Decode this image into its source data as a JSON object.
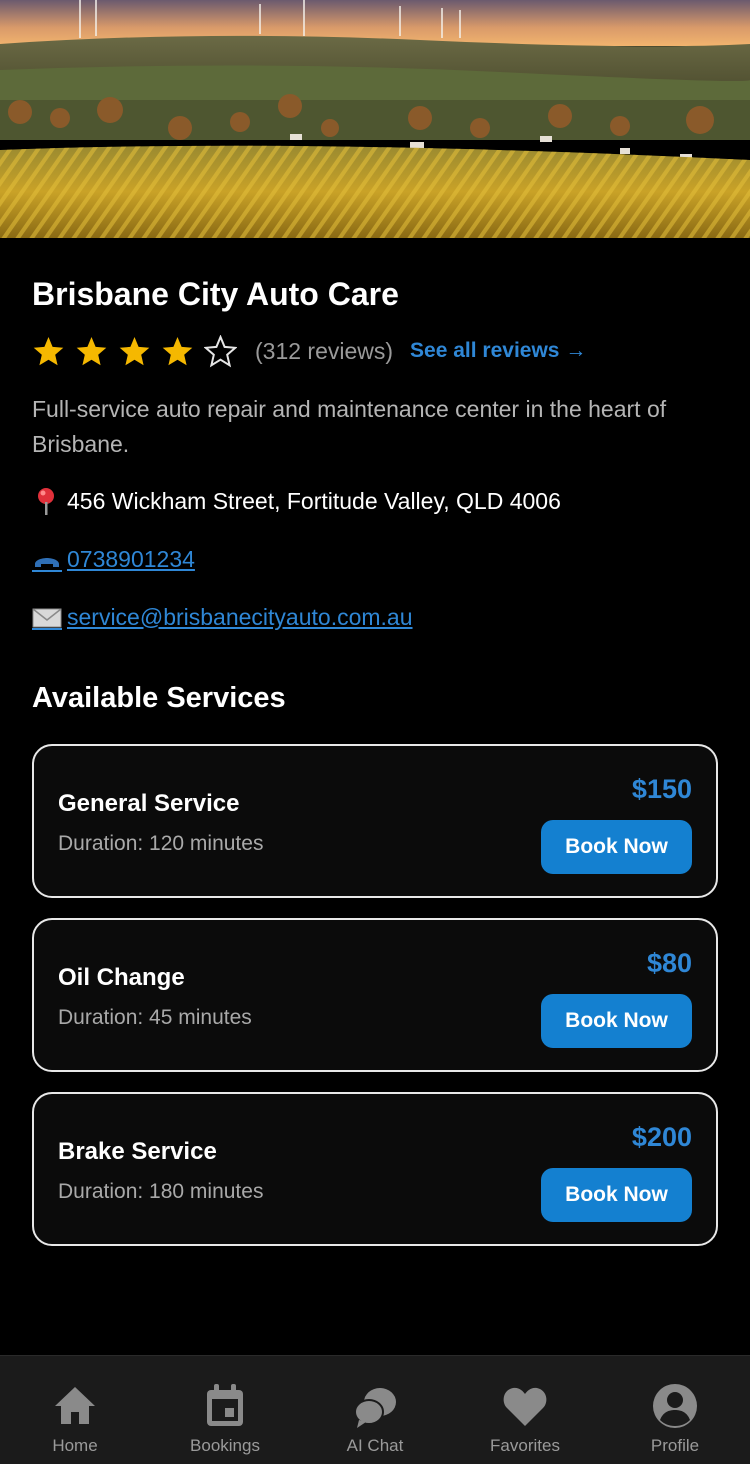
{
  "business": {
    "name": "Brisbane City Auto Care",
    "rating": 4,
    "rating_max": 5,
    "review_count_text": "(312 reviews)",
    "see_all_label": "See all reviews →",
    "description": "Full-service auto repair and maintenance center in the heart of Brisbane.",
    "address": "456 Wickham Street, Fortitude Valley, QLD 4006",
    "phone": "0738901234",
    "email": "service@brisbanecityauto.com.au",
    "address_icon": "map-pin-icon",
    "phone_icon": "telephone-icon",
    "email_icon": "envelope-icon"
  },
  "services_section": {
    "title": "Available Services",
    "items": [
      {
        "name": "General Service",
        "duration": "Duration: 120 minutes",
        "price": "$150",
        "button_label": "Book Now"
      },
      {
        "name": "Oil Change",
        "duration": "Duration: 45 minutes",
        "price": "$80",
        "button_label": "Book Now"
      },
      {
        "name": "Brake Service",
        "duration": "Duration: 180 minutes",
        "price": "$200",
        "button_label": "Book Now"
      }
    ]
  },
  "tabbar": {
    "items": [
      {
        "label": "Home",
        "icon": "home-icon"
      },
      {
        "label": "Bookings",
        "icon": "calendar-icon"
      },
      {
        "label": "AI Chat",
        "icon": "chat-icon"
      },
      {
        "label": "Favorites",
        "icon": "heart-icon"
      },
      {
        "label": "Profile",
        "icon": "profile-icon"
      }
    ]
  },
  "colors": {
    "accent": "#2f87d6",
    "button": "#1480d0",
    "star": "#f5b800",
    "background": "#000000",
    "card_border": "#e8e8e8",
    "tabbar_bg": "#1b1b1b"
  }
}
